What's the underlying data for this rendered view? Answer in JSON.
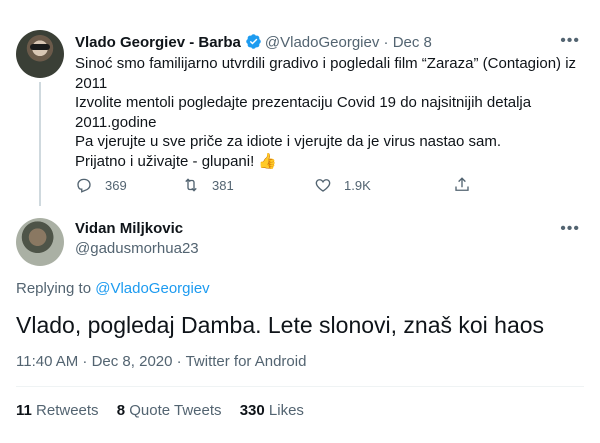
{
  "tweet1": {
    "author_name": "Vlado Georgiev - Barba",
    "handle": "@VladoGeorgiev",
    "separator": "·",
    "date": "Dec 8",
    "more_icon": "more-horizontal-icon",
    "lines": [
      "Sinoć smo familijarno utvrdili gradivo i pogledali film “Zaraza” (Contagion) iz 2011",
      "Izvolite mentoli pogledajte prezentaciju Covid 19 do najsitnijih detalja 2011.godine",
      "Pa vjerujte u sve priče za idiote i vjerujte da je virus nastao sam.",
      "Prijatno i uživajte - glupani! 👍"
    ],
    "replies": "369",
    "retweets": "381",
    "likes": "1.9K"
  },
  "tweet2": {
    "author_name": "Vidan Miljkovic",
    "handle": "@gadusmorhua23",
    "replying_prefix": "Replying to",
    "replying_to": "@VladoGeorgiev",
    "text": "Vlado, pogledaj Damba. Lete slonovi, znaš koi haos",
    "time": "11:40 AM · Dec 8, 2020 ·",
    "source": "Twitter for Android",
    "retweets_count": "11",
    "retweets_label": "Retweets",
    "quote_count": "8",
    "quote_label": "Quote Tweets",
    "likes_count": "330",
    "likes_label": "Likes"
  },
  "colors": {
    "text": "#0f1419",
    "secondary": "#536471",
    "accent": "#1d9bf0"
  }
}
